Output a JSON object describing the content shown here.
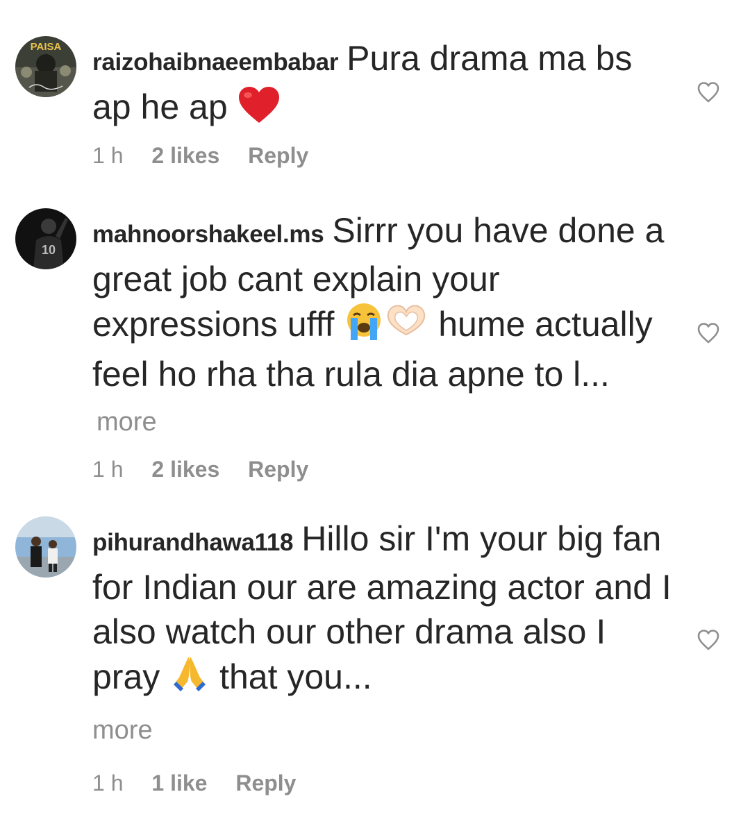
{
  "comments": [
    {
      "username": "raizohaibnaeembabar",
      "text_before": "Pura drama ma bs ap he ap",
      "emoji": "red-heart",
      "text_after": "",
      "more": "",
      "time": "1 h",
      "likes": "2 likes",
      "reply": "Reply",
      "avatar_text": "PAISA"
    },
    {
      "username": "mahnoorshakeel.ms",
      "text_before": "Sirrr you have done a great job cant explain your expressions ufff",
      "emoji": "crying-face, heart-hands",
      "text_after": "hume actually feel ho rha tha rula dia apne to l...",
      "more": "more",
      "time": "1 h",
      "likes": "2 likes",
      "reply": "Reply",
      "avatar_text": "10"
    },
    {
      "username": "pihurandhawa118",
      "text_before": "Hillo sir I'm your big fan for Indian our are amazing actor and I also watch our other drama also I pray",
      "emoji": "folded-hands",
      "text_after": "that you...",
      "more": "more",
      "time": "1 h",
      "likes": "1 like",
      "reply": "Reply",
      "avatar_text": ""
    }
  ],
  "colors": {
    "text": "#262626",
    "secondary": "#8e8e8e",
    "heart_emoji": "#e0202a"
  },
  "icons": [
    "like-heart-outline-icon",
    "red-heart-emoji",
    "crying-face-emoji",
    "heart-hands-emoji",
    "folded-hands-emoji"
  ]
}
